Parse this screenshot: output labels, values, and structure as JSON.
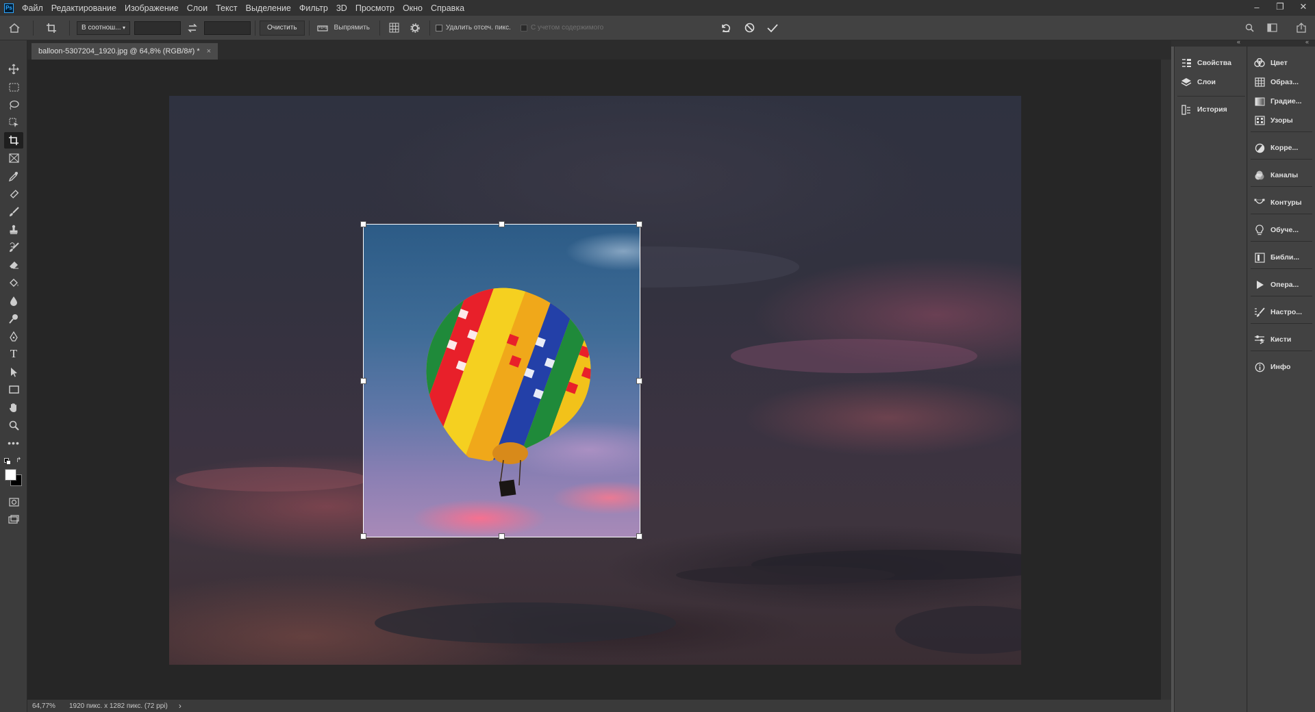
{
  "menubar": {
    "logo": "Ps",
    "items": [
      "Файл",
      "Редактирование",
      "Изображение",
      "Слои",
      "Текст",
      "Выделение",
      "Фильтр",
      "3D",
      "Просмотр",
      "Окно",
      "Справка"
    ],
    "window_controls": [
      "minimize-icon",
      "restore-icon",
      "close-icon"
    ]
  },
  "options": {
    "ratio_dropdown": "В соотнош...",
    "width_value": "",
    "height_value": "",
    "clear_label": "Очистить",
    "straighten_label": "Выпрямить",
    "delete_cropped_label": "Удалить отсеч. пикс.",
    "content_aware_label": "С учетом содержимого"
  },
  "document": {
    "tab_title": "balloon-5307204_1920.jpg @ 64,8% (RGB/8#) *",
    "close": "×"
  },
  "status": {
    "zoom": "64,77%",
    "info": "1920 пикс. x 1282 пикс. (72 ppi)",
    "arrow": "›"
  },
  "panels": {
    "col1": [
      {
        "label": "Свойства",
        "icon": "properties-icon"
      },
      {
        "label": "Слои",
        "icon": "layers-icon"
      },
      {
        "label": "История",
        "icon": "history-icon"
      }
    ],
    "col2": [
      {
        "label": "Цвет",
        "icon": "color-icon"
      },
      {
        "label": "Образ...",
        "icon": "swatches-icon"
      },
      {
        "label": "Градие...",
        "icon": "gradients-icon"
      },
      {
        "label": "Узоры",
        "icon": "patterns-icon"
      },
      {
        "label": "Корре...",
        "icon": "adjustments-icon"
      },
      {
        "label": "Каналы",
        "icon": "channels-icon"
      },
      {
        "label": "Контуры",
        "icon": "paths-icon"
      },
      {
        "label": "Обуче...",
        "icon": "learn-icon"
      },
      {
        "label": "Библи...",
        "icon": "libraries-icon"
      },
      {
        "label": "Опера...",
        "icon": "actions-icon"
      },
      {
        "label": "Настро...",
        "icon": "brush-settings-icon"
      },
      {
        "label": "Кисти",
        "icon": "brushes-icon"
      },
      {
        "label": "Инфо",
        "icon": "info-icon"
      }
    ]
  },
  "colors": {
    "bg": "#535353",
    "menubar": "#323232",
    "canvas_bg": "#262626",
    "accent": "#31a8ff"
  }
}
